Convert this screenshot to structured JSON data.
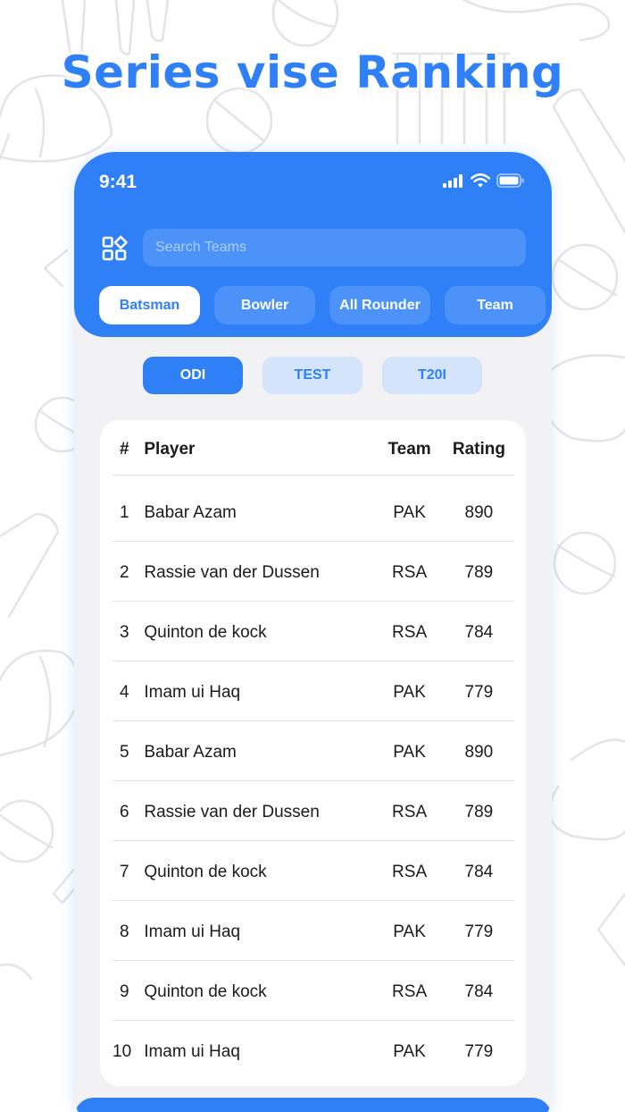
{
  "headline": "Series vise Ranking",
  "status_bar": {
    "time": "9:41"
  },
  "search": {
    "placeholder": "Search Teams"
  },
  "category_tabs": [
    {
      "label": "Batsman",
      "active": true
    },
    {
      "label": "Bowler",
      "active": false
    },
    {
      "label": "All Rounder",
      "active": false
    },
    {
      "label": "Team",
      "active": false
    }
  ],
  "format_tabs": [
    {
      "label": "ODI",
      "active": true
    },
    {
      "label": "TEST",
      "active": false
    },
    {
      "label": "T20I",
      "active": false
    }
  ],
  "table": {
    "headers": {
      "num": "#",
      "player": "Player",
      "team": "Team",
      "rating": "Rating"
    },
    "rows": [
      {
        "num": "1",
        "player": "Babar Azam",
        "team": "PAK",
        "rating": "890"
      },
      {
        "num": "2",
        "player": "Rassie van der Dussen",
        "team": "RSA",
        "rating": "789"
      },
      {
        "num": "3",
        "player": "Quinton de kock",
        "team": "RSA",
        "rating": "784"
      },
      {
        "num": "4",
        "player": "Imam ui Haq",
        "team": "PAK",
        "rating": "779"
      },
      {
        "num": "5",
        "player": "Babar Azam",
        "team": "PAK",
        "rating": "890"
      },
      {
        "num": "6",
        "player": "Rassie van der Dussen",
        "team": "RSA",
        "rating": "789"
      },
      {
        "num": "7",
        "player": "Quinton de kock",
        "team": "RSA",
        "rating": "784"
      },
      {
        "num": "8",
        "player": "Imam ui Haq",
        "team": "PAK",
        "rating": "779"
      },
      {
        "num": "9",
        "player": "Quinton de kock",
        "team": "RSA",
        "rating": "784"
      },
      {
        "num": "10",
        "player": "Imam ui Haq",
        "team": "PAK",
        "rating": "779"
      }
    ]
  },
  "colors": {
    "accent": "#2f80f7",
    "tab_inactive_bg": "#d4e4fb",
    "panel_bg": "#f2f2f4"
  },
  "icons": [
    "menu-grid-icon",
    "signal-icon",
    "wifi-icon",
    "battery-icon"
  ]
}
